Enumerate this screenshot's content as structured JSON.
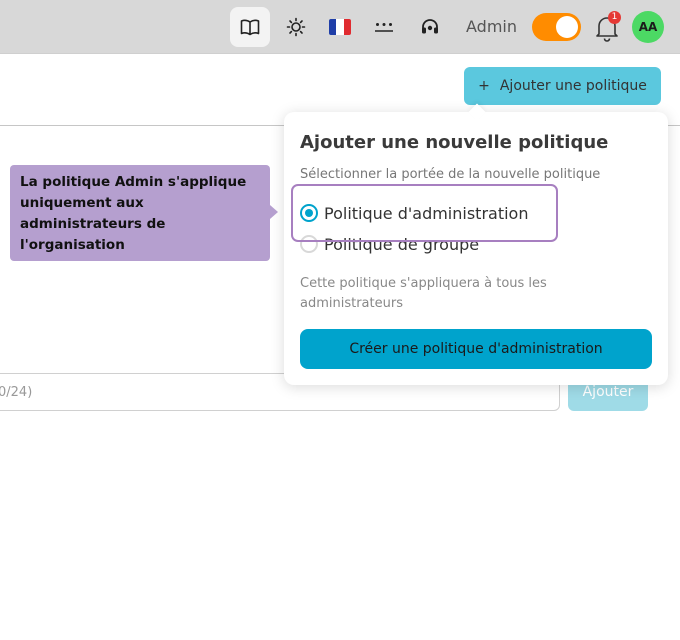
{
  "header": {
    "admin_label": "Admin",
    "notification_count": "1",
    "avatar_initials": "AA",
    "icons": [
      "book-open-icon",
      "sun-icon",
      "french-flag-icon",
      "password-dots-icon",
      "support-headset-icon",
      "bell-icon"
    ]
  },
  "toolbar": {
    "add_policy_plus": "+",
    "add_policy_label": "Ajouter une politique"
  },
  "popover": {
    "title": "Ajouter une nouvelle politique",
    "subtitle": "Sélectionner la portée de la nouvelle politique",
    "options": [
      {
        "label": "Politique d'administration",
        "selected": true
      },
      {
        "label": "Politique de groupe",
        "selected": false
      }
    ],
    "description": "Cette politique s'appliquera à tous les administrateurs",
    "create_label": "Créer une politique d'administration"
  },
  "tooltip": {
    "text": "La politique Admin s'applique uniquement aux administrateurs de l'organisation"
  },
  "background_form": {
    "input_counter": "0/24)",
    "add_label": "Ajouter"
  },
  "colors": {
    "accent": "#00a3cc",
    "toggle": "#ff8c00",
    "tooltip": "#b59fcf",
    "avatar": "#4cd964"
  }
}
